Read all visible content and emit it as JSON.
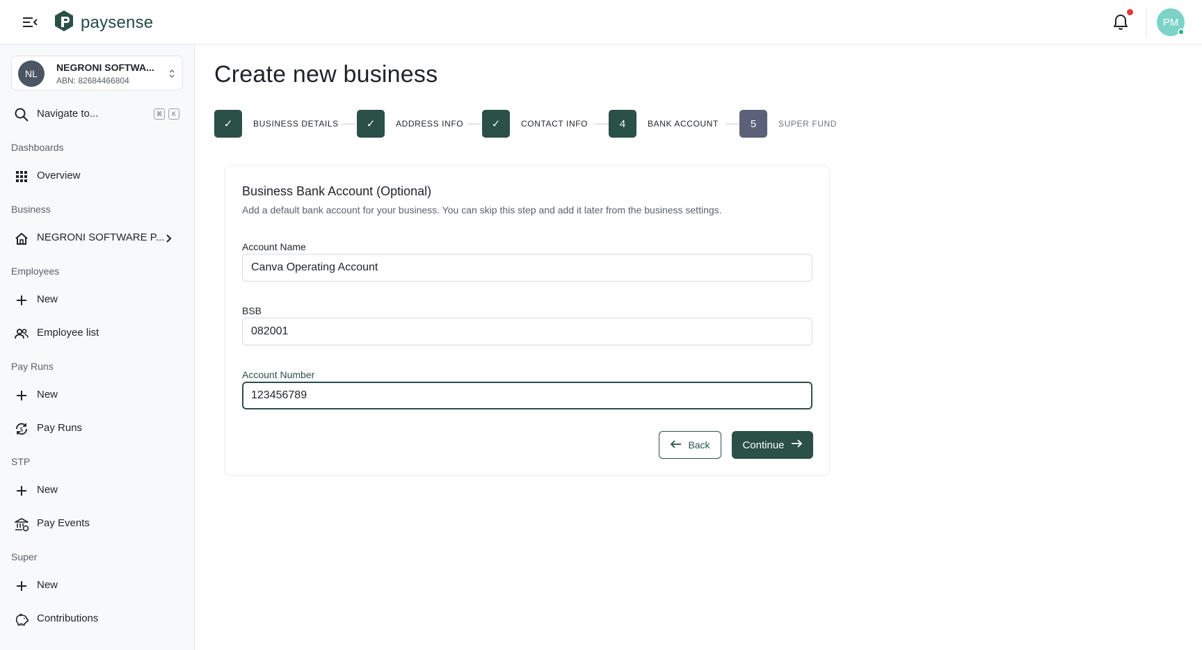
{
  "header": {
    "brand_name": "paysense",
    "avatar_initials": "PM",
    "menu_icon": "menu-collapse-icon",
    "notification_icon": "bell-icon",
    "accent_color": "#2a5048"
  },
  "sidebar": {
    "business": {
      "initials": "NL",
      "name": "NEGRONI SOFTWA...",
      "abn": "ABN: 82684466804"
    },
    "navigate": {
      "label": "Navigate to...",
      "shortcut_mod": "⌘",
      "shortcut_key": "K"
    },
    "sections": {
      "dashboards": "Dashboards",
      "business": "Business",
      "employees": "Employees",
      "pay_runs": "Pay Runs",
      "stp": "STP",
      "super": "Super"
    },
    "items": {
      "overview": "Overview",
      "business_name": "NEGRONI SOFTWARE P...",
      "employee_new": "New",
      "employee_list": "Employee list",
      "payrun_new": "New",
      "pay_runs": "Pay Runs",
      "stp_new": "New",
      "pay_events": "Pay Events",
      "super_new": "New",
      "contributions": "Contributions"
    }
  },
  "main": {
    "title": "Create new business",
    "steps": [
      {
        "label": "BUSINESS DETAILS",
        "state": "done",
        "marker": "✓"
      },
      {
        "label": "ADDRESS INFO",
        "state": "done",
        "marker": "✓"
      },
      {
        "label": "CONTACT INFO",
        "state": "done",
        "marker": "✓"
      },
      {
        "label": "BANK ACCOUNT",
        "state": "active",
        "marker": "4"
      },
      {
        "label": "SUPER FUND",
        "state": "pending",
        "marker": "5"
      }
    ],
    "card": {
      "title": "Business Bank Account (Optional)",
      "description": "Add a default bank account for your business. You can skip this step and add it later from the business settings.",
      "fields": {
        "account_name": {
          "label": "Account Name",
          "value": "Canva Operating Account"
        },
        "bsb": {
          "label": "BSB",
          "value": "082001"
        },
        "account_number": {
          "label": "Account Number",
          "value": "123456789"
        }
      },
      "back_label": "Back",
      "continue_label": "Continue"
    }
  }
}
